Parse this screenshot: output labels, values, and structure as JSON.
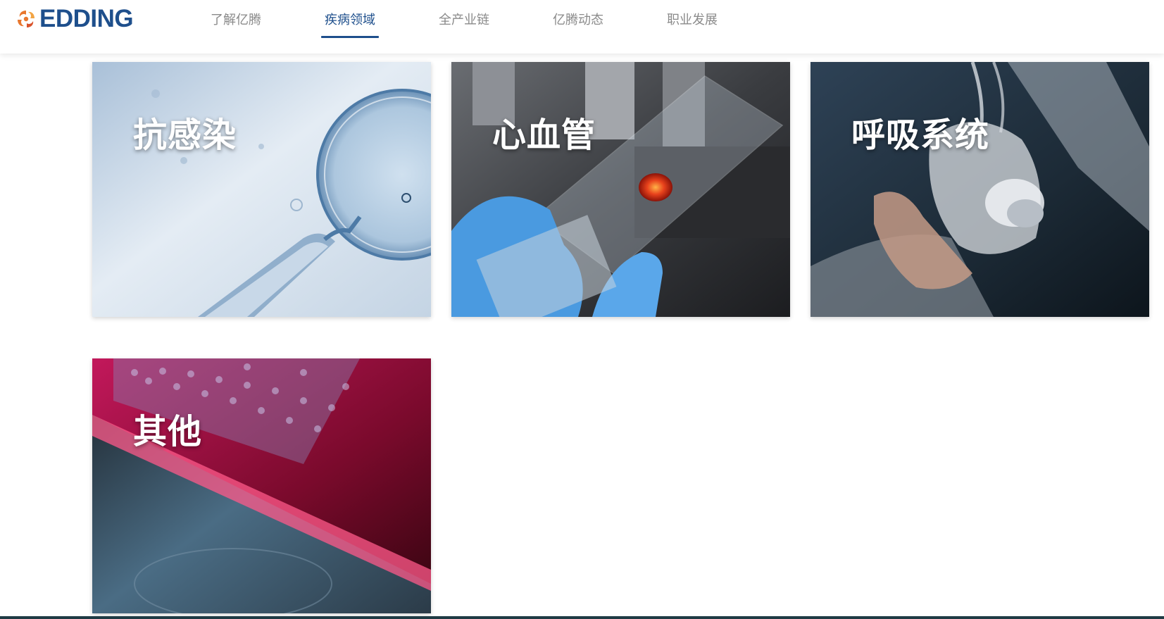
{
  "header": {
    "logo_text": "EDDING",
    "logo_icon": "edding-swirl-icon",
    "brand_color": "#1e4f8c",
    "nav_inactive_color": "#8a8a8a"
  },
  "nav": [
    {
      "label": "了解亿腾",
      "active": false
    },
    {
      "label": "疾病领域",
      "active": true
    },
    {
      "label": "全产业链",
      "active": false
    },
    {
      "label": "亿腾动态",
      "active": false
    },
    {
      "label": "职业发展",
      "active": false
    }
  ],
  "cards": [
    {
      "title": "抗感染",
      "image": "microinjection-cell-photo"
    },
    {
      "title": "心血管",
      "image": "blood-slide-microscope-photo"
    },
    {
      "title": "呼吸系统",
      "image": "oxygen-mask-photo"
    },
    {
      "title": "其他",
      "image": "red-liquid-test-tube-photo"
    }
  ]
}
